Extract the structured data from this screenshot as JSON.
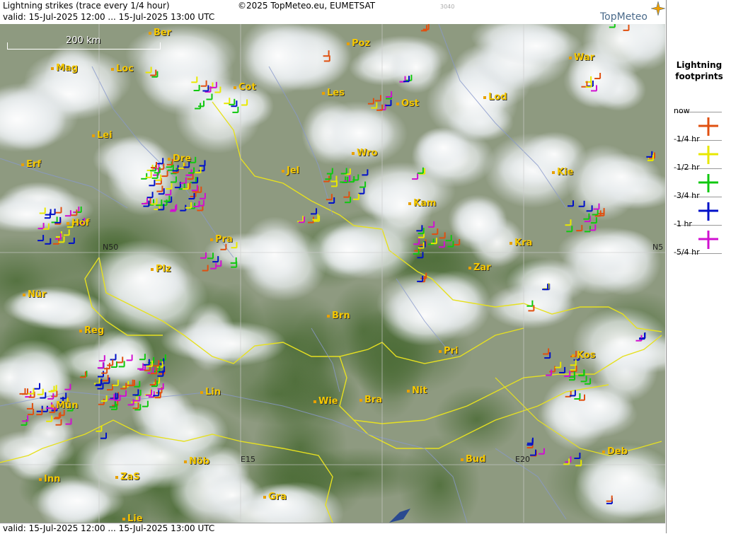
{
  "header": {
    "title": "Lightning strikes (trace every 1/4 hour)",
    "valid": "valid:  15-Jul-2025 12:00 ... 15-Jul-2025 13:00 UTC",
    "copyright": "©2025 TopMeteo.eu, EUMETSAT",
    "code": "3040",
    "logo": "TopMeteo"
  },
  "footer": {
    "valid": "valid:  15-Jul-2025 12:00 ... 15-Jul-2025 13:00 UTC"
  },
  "scale": {
    "label": "200 km"
  },
  "legend": {
    "title_line1": "Lightning",
    "title_line2": "footprints",
    "items": [
      {
        "label": "now",
        "color": "#e05010"
      },
      {
        "label": "-1/4 hr",
        "color": "#e8e800"
      },
      {
        "label": "-1/2 hr",
        "color": "#10c810"
      },
      {
        "label": "-3/4 hr",
        "color": "#0010c8"
      },
      {
        "label": "-1 hr",
        "color": "#d010d0"
      },
      {
        "label": "-5/4 hr",
        "color": ""
      }
    ]
  },
  "grid_labels": [
    "N50",
    "N5",
    "E15",
    "E20"
  ],
  "cities": [
    {
      "name": "Ber"
    },
    {
      "name": "Poz"
    },
    {
      "name": "War"
    },
    {
      "name": "Mag"
    },
    {
      "name": "Loc"
    },
    {
      "name": "Cot"
    },
    {
      "name": "Les"
    },
    {
      "name": "Ost"
    },
    {
      "name": "Lod"
    },
    {
      "name": "Lei"
    },
    {
      "name": "Dre"
    },
    {
      "name": "Wro"
    },
    {
      "name": "Erf"
    },
    {
      "name": "Jel"
    },
    {
      "name": "Kie"
    },
    {
      "name": "Hof"
    },
    {
      "name": "Kam"
    },
    {
      "name": "Pra"
    },
    {
      "name": "Kra"
    },
    {
      "name": "Plz"
    },
    {
      "name": "Zar"
    },
    {
      "name": "Nür"
    },
    {
      "name": "Brn"
    },
    {
      "name": "Reg"
    },
    {
      "name": "Pri"
    },
    {
      "name": "Kos"
    },
    {
      "name": "Lin"
    },
    {
      "name": "Nit"
    },
    {
      "name": "Mün"
    },
    {
      "name": "Wie"
    },
    {
      "name": "Bra"
    },
    {
      "name": "Deb"
    },
    {
      "name": "Nöb"
    },
    {
      "name": "Bud"
    },
    {
      "name": "Inn"
    },
    {
      "name": "ZaS"
    },
    {
      "name": "Gra"
    },
    {
      "name": "Lie"
    }
  ]
}
